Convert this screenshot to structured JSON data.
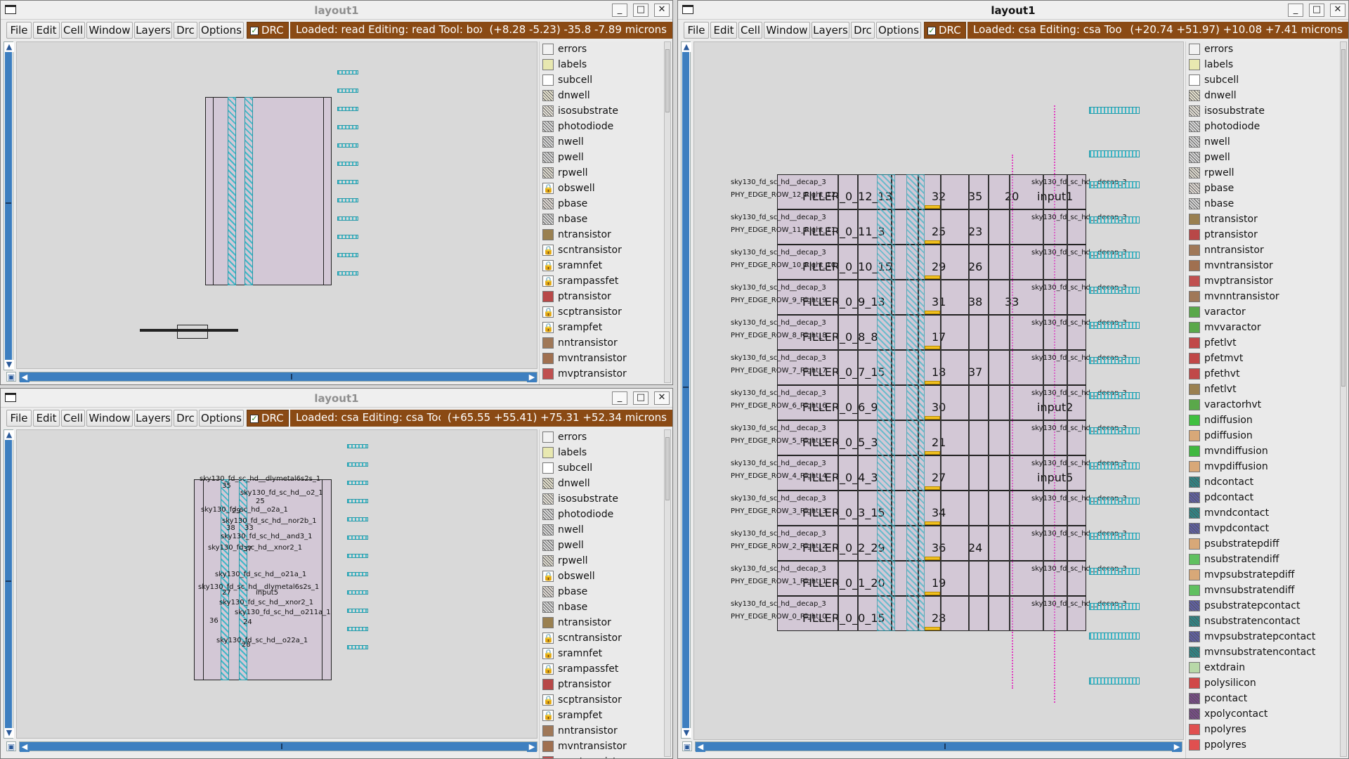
{
  "menu": [
    "File",
    "Edit",
    "Cell",
    "Window",
    "Layers",
    "Drc",
    "Options"
  ],
  "drc_label": "DRC",
  "windows": {
    "top_left": {
      "title": "layout1",
      "status": "Loaded: read Editing: read Tool: box  Tech",
      "coords": "(+8.28 -5.23) -35.8 -7.89 microns"
    },
    "bottom_left": {
      "title": "layout1",
      "status": "Loaded: csa Editing: csa Tool: box",
      "coords": "(+65.55 +55.41) +75.31 +52.34 microns"
    },
    "right": {
      "title": "layout1",
      "status": "Loaded: csa Editing: csa Tool: box  `",
      "coords": "(+20.74 +51.97) +10.08 +7.41 microns"
    }
  },
  "window_buttons": {
    "minimize": "_",
    "maximize": "□",
    "close": "✕"
  },
  "layers_left": [
    "errors",
    "labels",
    "subcell",
    "dnwell",
    "isosubstrate",
    "photodiode",
    "nwell",
    "pwell",
    "rpwell",
    "obswell",
    "pbase",
    "nbase",
    "ntransistor",
    "scntransistor",
    "sramnfet",
    "srampassfet",
    "ptransistor",
    "scptransistor",
    "srampfet",
    "nntransistor",
    "mvntransistor",
    "mvptransistor"
  ],
  "layers_right": [
    "errors",
    "labels",
    "subcell",
    "dnwell",
    "isosubstrate",
    "photodiode",
    "nwell",
    "pwell",
    "rpwell",
    "pbase",
    "nbase",
    "ntransistor",
    "ptransistor",
    "nntransistor",
    "mvntransistor",
    "mvptransistor",
    "mvnntransistor",
    "varactor",
    "mvvaractor",
    "pfetlvt",
    "pfetmvt",
    "pfethvt",
    "nfetlvt",
    "varactorhvt",
    "ndiffusion",
    "pdiffusion",
    "mvndiffusion",
    "mvpdiffusion",
    "ndcontact",
    "pdcontact",
    "mvndcontact",
    "mvpdcontact",
    "psubstratepdiff",
    "nsubstratendiff",
    "mvpsubstratepdiff",
    "mvnsubstratendiff",
    "psubstratepcontact",
    "nsubstratencontact",
    "mvpsubstratepcontact",
    "mvnsubstratencontact",
    "extdrain",
    "polysilicon",
    "pcontact",
    "xpolycontact",
    "npolyres",
    "ppolyres"
  ],
  "layer_colors": {
    "errors": "#f2f2f2",
    "labels": "#e8e8b0",
    "subcell": "#ffffff",
    "dnwell": "#e8e4d0",
    "isosubstrate": "#e6e2d8",
    "photodiode": "#dcdcdc",
    "nwell": "#d8d8d8",
    "pwell": "#d8d8d8",
    "rpwell": "#e0dcd0",
    "obswell": "#ffffff",
    "pbase": "#e2dcd6",
    "nbase": "#d8d8d8",
    "ntransistor": "#9a8050",
    "scntransistor": "#ffffff",
    "sramnfet": "#ffffff",
    "srampassfet": "#ffffff",
    "ptransistor": "#b84848",
    "scptransistor": "#ffffff",
    "srampfet": "#ffffff",
    "nntransistor": "#a07858",
    "mvntransistor": "#a07050",
    "mvptransistor": "#c05050",
    "mvnntransistor": "#a07858",
    "varactor": "#5aa84a",
    "mvvaractor": "#5aa84a",
    "pfetlvt": "#c04848",
    "pfetmvt": "#c04848",
    "pfethvt": "#c04848",
    "nfetlvt": "#9a8050",
    "varactorhvt": "#5aa84a",
    "ndiffusion": "#40c040",
    "pdiffusion": "#d8a878",
    "mvndiffusion": "#40b840",
    "mvpdiffusion": "#d8a878",
    "ndcontact": "#2a8a8a",
    "pdcontact": "#6060a8",
    "mvndcontact": "#2a8a8a",
    "mvpdcontact": "#6060a8",
    "psubstratepdiff": "#d8a878",
    "nsubstratendiff": "#60c060",
    "mvpsubstratepdiff": "#d8a878",
    "mvnsubstratendiff": "#60c060",
    "psubstratepcontact": "#6060a8",
    "nsubstratencontact": "#2a8a8a",
    "mvpsubstratepcontact": "#6060a8",
    "mvnsubstratencontact": "#2a8a8a",
    "extdrain": "#b8d8a8",
    "polysilicon": "#d04848",
    "pcontact": "#7a4a8a",
    "xpolycontact": "#7a4a8a",
    "npolyres": "#e05050",
    "ppolyres": "#e05050"
  },
  "locked_layers": [
    "obswell",
    "scntransistor",
    "sramnfet",
    "srampassfet",
    "scptransistor",
    "srampfet"
  ],
  "bottom_left_cells": [
    "sky130_fd_sc_hd__dlymetal6s2s_1",
    "35",
    "sky130_fd_sc_hd__o2_1",
    "25",
    "sky130_fd_sc_hd__o2a_1",
    "29",
    "sky130_fd_sc_hd__nor2b_1",
    "38",
    "33",
    "sky130_fd_sc_hd__and3_1",
    "sky130_fd_sc_hd__xnor2_1",
    "37",
    "sky130_fd_sc_hd__o21a_1",
    "sky130_fd_sc_hd__dlymetal6s2s_1",
    "27",
    "input5",
    "sky130_fd_sc_hd__xnor2_1",
    "sky130_fd_sc_hd__o211a_1",
    "36",
    "24",
    "sky130_fd_sc_hd__o22a_1",
    "28"
  ],
  "right_rows": [
    {
      "left": "sky130_fd_sc_hd__decap_3",
      "edge": "PHY_EDGE_ROW_12_Right_12",
      "fill": "FILLER_0_12_13",
      "nums": [
        "32",
        "35",
        "20"
      ],
      "input": "input1",
      "right": "sky130_fd_sc_hd__decap_3"
    },
    {
      "left": "sky130_fd_sc_hd__decap_3",
      "edge": "PHY_EDGE_ROW_11_Right_11",
      "fill": "FILLER_0_11_3",
      "nums": [
        "25",
        "23"
      ],
      "input": "",
      "right": "sky130_fd_sc_hd__decap_3"
    },
    {
      "left": "sky130_fd_sc_hd__decap_3",
      "edge": "PHY_EDGE_ROW_10_Right_10",
      "fill": "FILLER_0_10_15",
      "nums": [
        "29",
        "26"
      ],
      "input": "",
      "right": "sky130_fd_sc_hd__decap_3"
    },
    {
      "left": "sky130_fd_sc_hd__decap_3",
      "edge": "PHY_EDGE_ROW_9_Right_9",
      "fill": "FILLER_0_9_13",
      "nums": [
        "31",
        "38",
        "33"
      ],
      "input": "",
      "right": "sky130_fd_sc_hd__decap_3"
    },
    {
      "left": "sky130_fd_sc_hd__decap_3",
      "edge": "PHY_EDGE_ROW_8_Right_8",
      "fill": "FILLER_0_8_8",
      "nums": [
        "17"
      ],
      "input": "",
      "right": "sky130_fd_sc_hd__decap_3"
    },
    {
      "left": "sky130_fd_sc_hd__decap_3",
      "edge": "PHY_EDGE_ROW_7_Right_7",
      "fill": "FILLER_0_7_15",
      "nums": [
        "18",
        "37"
      ],
      "input": "",
      "right": "sky130_fd_sc_hd__decap_3"
    },
    {
      "left": "sky130_fd_sc_hd__decap_3",
      "edge": "PHY_EDGE_ROW_6_Right_6",
      "fill": "FILLER_0_6_9",
      "nums": [
        "30"
      ],
      "input": "input2",
      "right": "sky130_fd_sc_hd__decap_3"
    },
    {
      "left": "sky130_fd_sc_hd__decap_3",
      "edge": "PHY_EDGE_ROW_5_Right_5",
      "fill": "FILLER_0_5_3",
      "nums": [
        "21"
      ],
      "input": "",
      "right": "sky130_fd_sc_hd__decap_3"
    },
    {
      "left": "sky130_fd_sc_hd__decap_3",
      "edge": "PHY_EDGE_ROW_4_Right_4",
      "fill": "FILLER_0_4_3",
      "nums": [
        "27"
      ],
      "input": "input5",
      "right": "sky130_fd_sc_hd__decap_3"
    },
    {
      "left": "sky130_fd_sc_hd__decap_3",
      "edge": "PHY_EDGE_ROW_3_Right_3",
      "fill": "FILLER_0_3_15",
      "nums": [
        "34"
      ],
      "input": "",
      "right": "sky130_fd_sc_hd__decap_3"
    },
    {
      "left": "sky130_fd_sc_hd__decap_3",
      "edge": "PHY_EDGE_ROW_2_Right_2",
      "fill": "FILLER_0_2_29",
      "nums": [
        "36",
        "24"
      ],
      "input": "",
      "right": "sky130_fd_sc_hd__decap_3"
    },
    {
      "left": "sky130_fd_sc_hd__decap_3",
      "edge": "PHY_EDGE_ROW_1_Right_1",
      "fill": "FILLER_0_1_20",
      "nums": [
        "19"
      ],
      "input": "",
      "right": "sky130_fd_sc_hd__decap_3"
    },
    {
      "left": "sky130_fd_sc_hd__decap_3",
      "edge": "PHY_EDGE_ROW_0_Right_0",
      "fill": "FILLER_0_0_15",
      "nums": [
        "28"
      ],
      "input": "",
      "right": "sky130_fd_sc_hd__decap_3"
    }
  ]
}
